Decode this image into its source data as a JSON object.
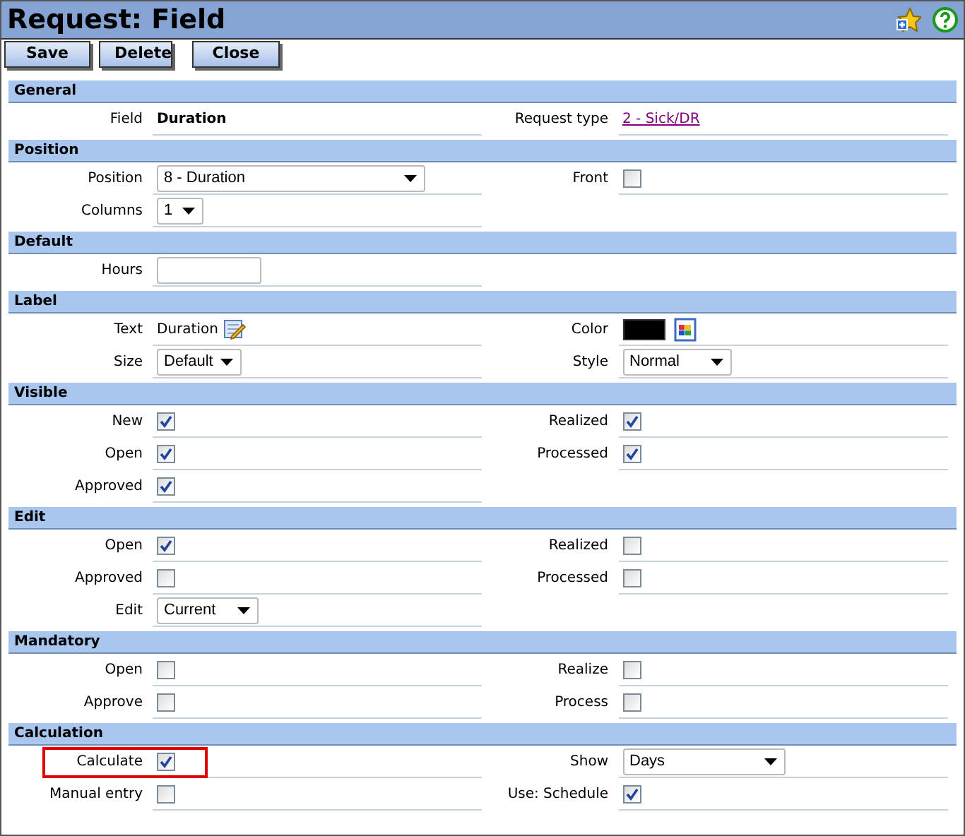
{
  "window": {
    "title": "Request: Field"
  },
  "buttons": [
    {
      "label": "Save"
    },
    {
      "label": "Delete"
    },
    {
      "label": "Close"
    }
  ],
  "sections": [
    {
      "title": "General",
      "rows": [
        {
          "left": {
            "label": "Field",
            "kind": "text",
            "value": "Duration"
          },
          "right": {
            "label": "Request type",
            "kind": "link",
            "value": "2 - Sick/DR"
          }
        }
      ]
    },
    {
      "title": "Position",
      "rows": [
        {
          "left": {
            "label": "Position",
            "kind": "select",
            "value": "8 - Duration"
          },
          "right": {
            "label": "Front",
            "kind": "checkbox",
            "checked": false
          }
        },
        {
          "left": {
            "label": "Columns",
            "kind": "select",
            "value": "1"
          }
        }
      ]
    },
    {
      "title": "Default",
      "rows": [
        {
          "left": {
            "label": "Hours",
            "kind": "input"
          }
        }
      ]
    },
    {
      "title": "Label",
      "rows": [
        {
          "left": {
            "label": "Text",
            "kind": "edit_text",
            "value": "Duration"
          },
          "right": {
            "label": "Color",
            "kind": "color",
            "color": "#000000"
          }
        },
        {
          "left": {
            "label": "Size",
            "kind": "select",
            "value": "Default"
          },
          "right": {
            "label": "Style",
            "kind": "select",
            "value": "Normal"
          }
        }
      ]
    },
    {
      "title": "Visible",
      "rows": [
        {
          "left": {
            "label": "New",
            "kind": "checkbox",
            "checked": true
          },
          "right": {
            "label": "Realized",
            "kind": "checkbox",
            "checked": true
          }
        },
        {
          "left": {
            "label": "Open",
            "kind": "checkbox",
            "checked": true
          },
          "right": {
            "label": "Processed",
            "kind": "checkbox",
            "checked": true
          }
        },
        {
          "left": {
            "label": "Approved",
            "kind": "checkbox",
            "checked": true
          }
        }
      ]
    },
    {
      "title": "Edit",
      "rows": [
        {
          "left": {
            "label": "Open",
            "kind": "checkbox",
            "checked": true
          },
          "right": {
            "label": "Realized",
            "kind": "checkbox",
            "checked": false
          }
        },
        {
          "left": {
            "label": "Approved",
            "kind": "checkbox",
            "checked": false
          },
          "right": {
            "label": "Processed",
            "kind": "checkbox",
            "checked": false
          }
        },
        {
          "left": {
            "label": "Edit",
            "kind": "select",
            "value": "Current"
          }
        }
      ]
    },
    {
      "title": "Mandatory",
      "rows": [
        {
          "left": {
            "label": "Open",
            "kind": "checkbox",
            "checked": false
          },
          "right": {
            "label": "Realize",
            "kind": "checkbox",
            "checked": false
          }
        },
        {
          "left": {
            "label": "Approve",
            "kind": "checkbox",
            "checked": false
          },
          "right": {
            "label": "Process",
            "kind": "checkbox",
            "checked": false
          }
        }
      ]
    },
    {
      "title": "Calculation",
      "rows": [
        {
          "left": {
            "label": "Calculate",
            "kind": "checkbox",
            "checked": true,
            "highlighted": true
          },
          "right": {
            "label": "Show",
            "kind": "select",
            "value": "Days"
          }
        },
        {
          "left": {
            "label": "Manual entry",
            "kind": "checkbox",
            "checked": false
          },
          "right": {
            "label": "Use: Schedule",
            "kind": "checkbox",
            "checked": true
          }
        }
      ]
    }
  ]
}
